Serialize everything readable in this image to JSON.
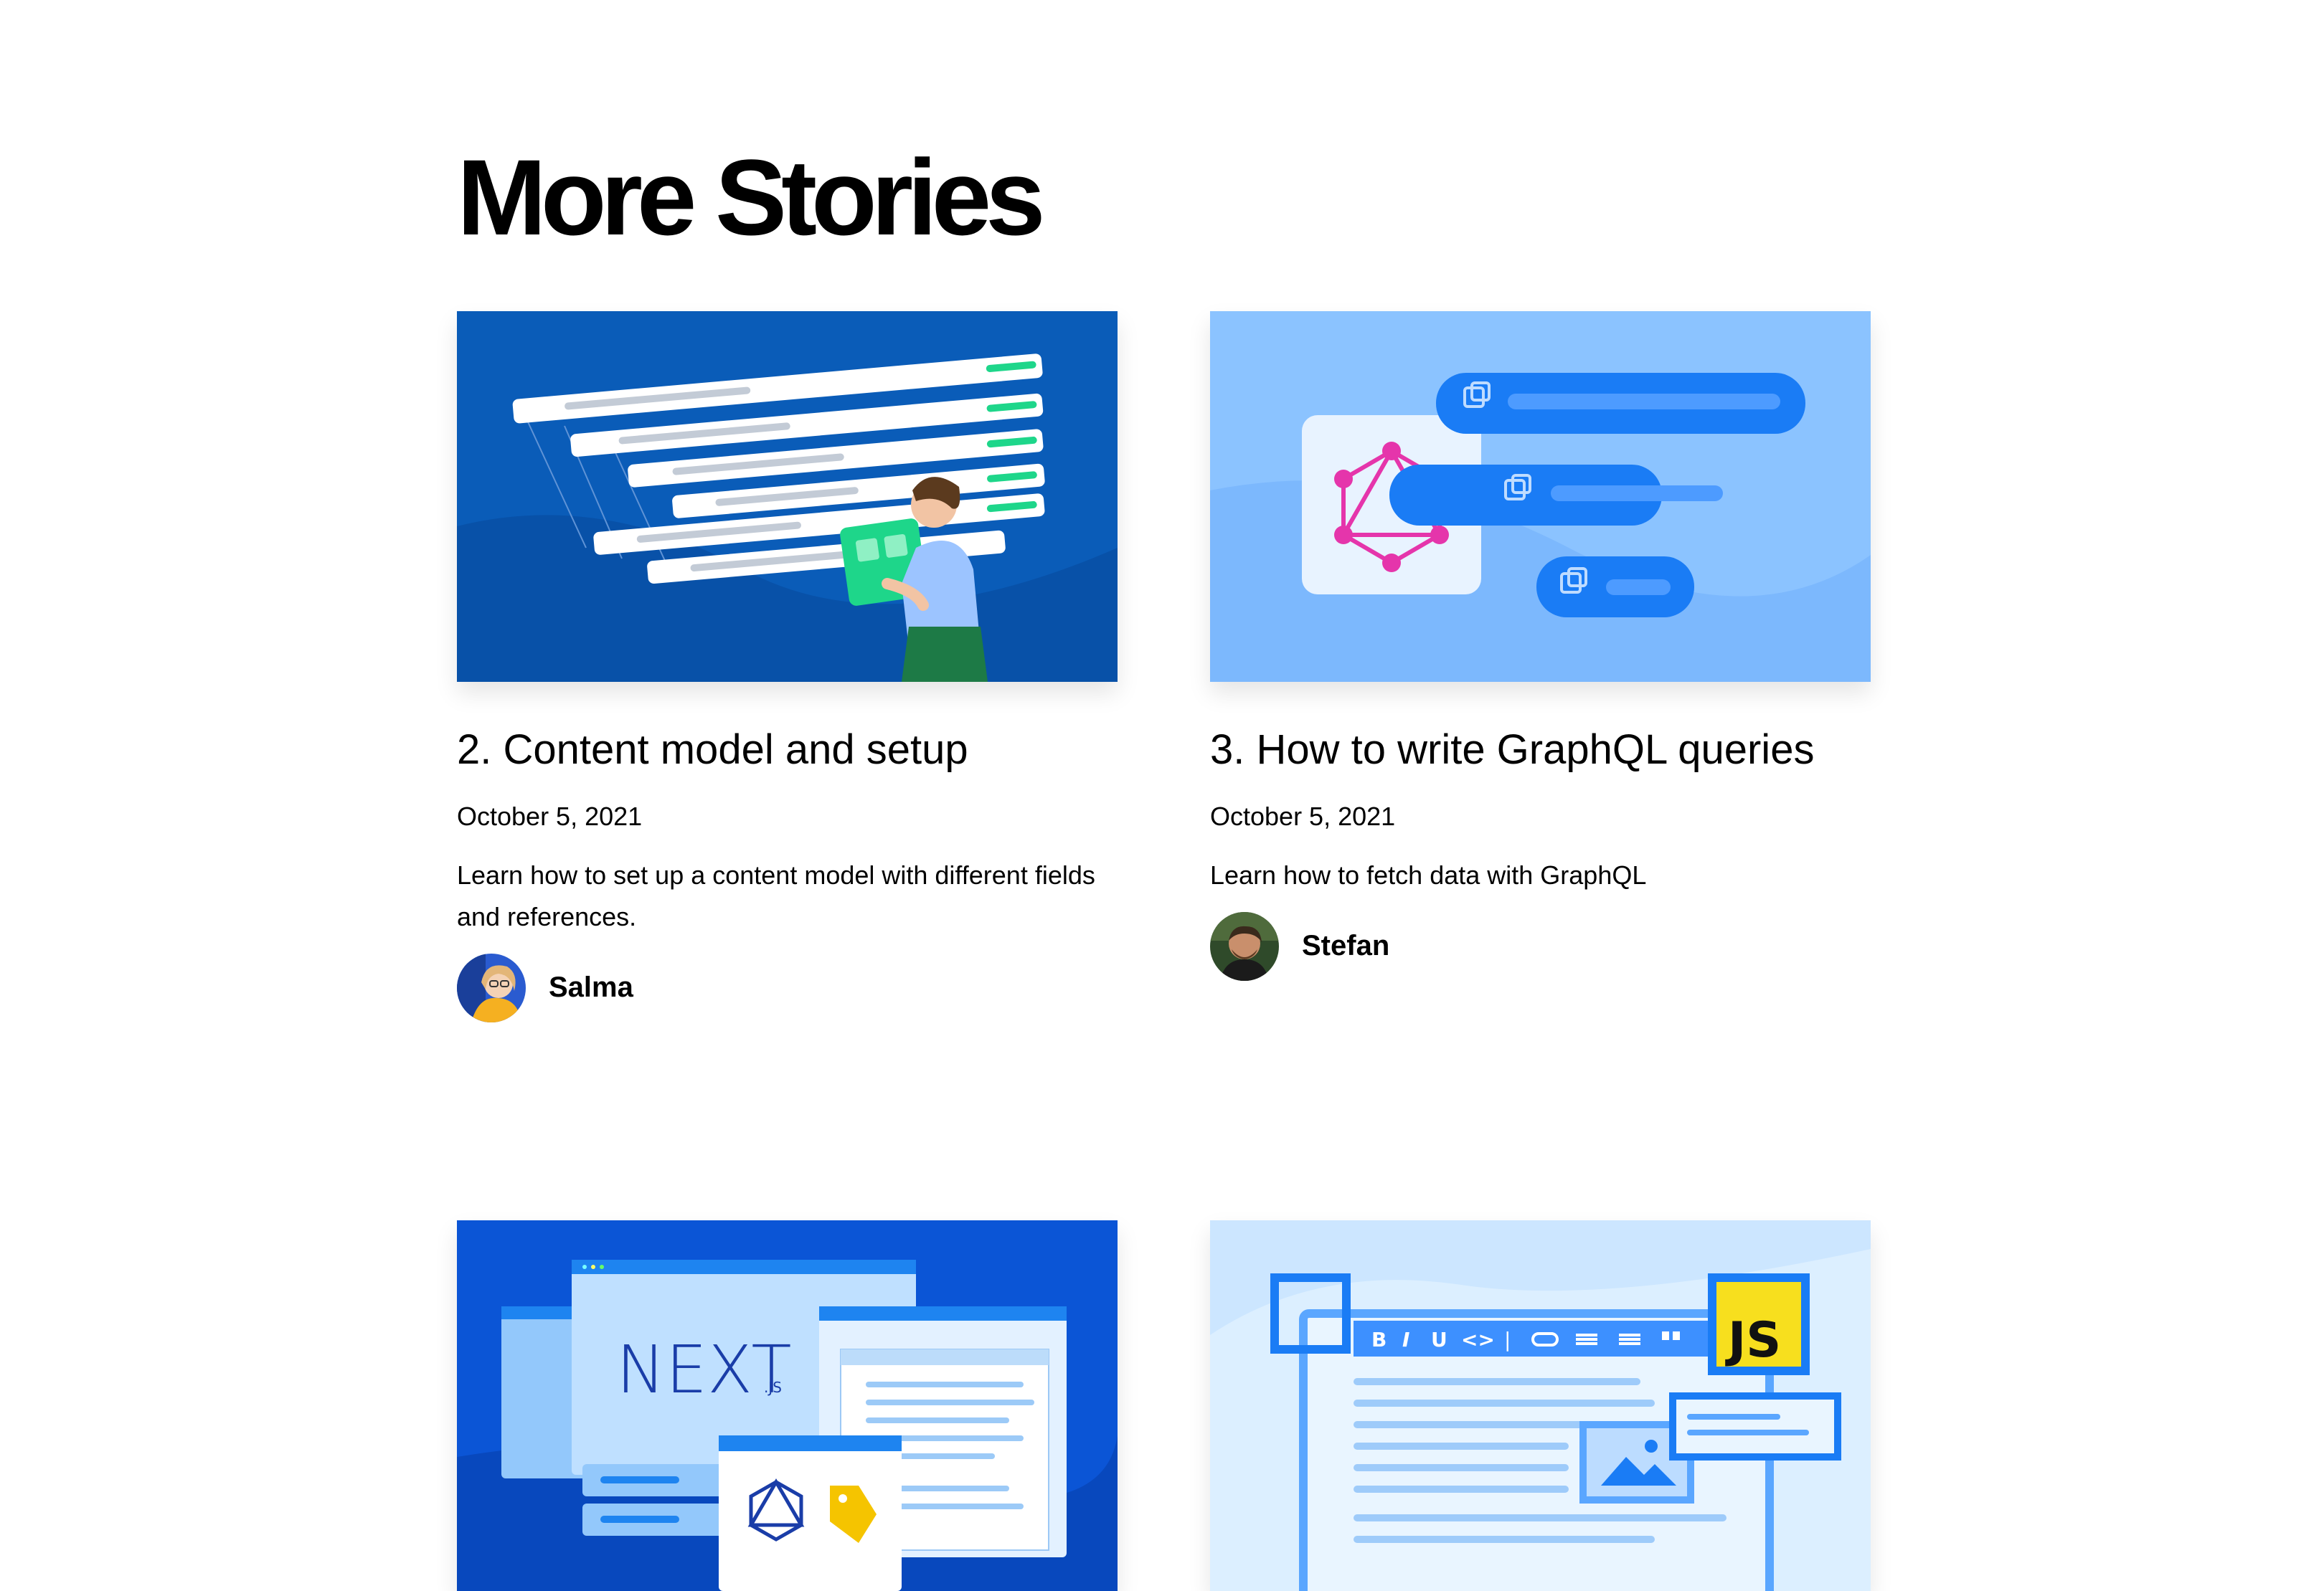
{
  "section": {
    "title": "More Stories"
  },
  "posts": [
    {
      "title": "2. Content model and setup",
      "date": "October 5, 2021",
      "excerpt": "Learn how to set up a content model with different fields and references.",
      "author": "Salma",
      "image_icon": "content-model-illustration"
    },
    {
      "title": "3. How to write GraphQL queries",
      "date": "October 5, 2021",
      "excerpt": "Learn how to fetch data with GraphQL",
      "author": "Stefan",
      "image_icon": "graphql-illustration"
    },
    {
      "image_icon": "nextjs-illustration",
      "image_text": "NEXT",
      "image_subtext": ".JS"
    },
    {
      "image_icon": "rich-text-editor-illustration",
      "image_text": "JS",
      "toolbar": [
        "B",
        "I",
        "U",
        "<>",
        "|"
      ]
    }
  ],
  "colors": {
    "accent_blue": "#1a7cf5",
    "graphql_pink": "#e535ab",
    "js_yellow": "#f7df1e"
  }
}
